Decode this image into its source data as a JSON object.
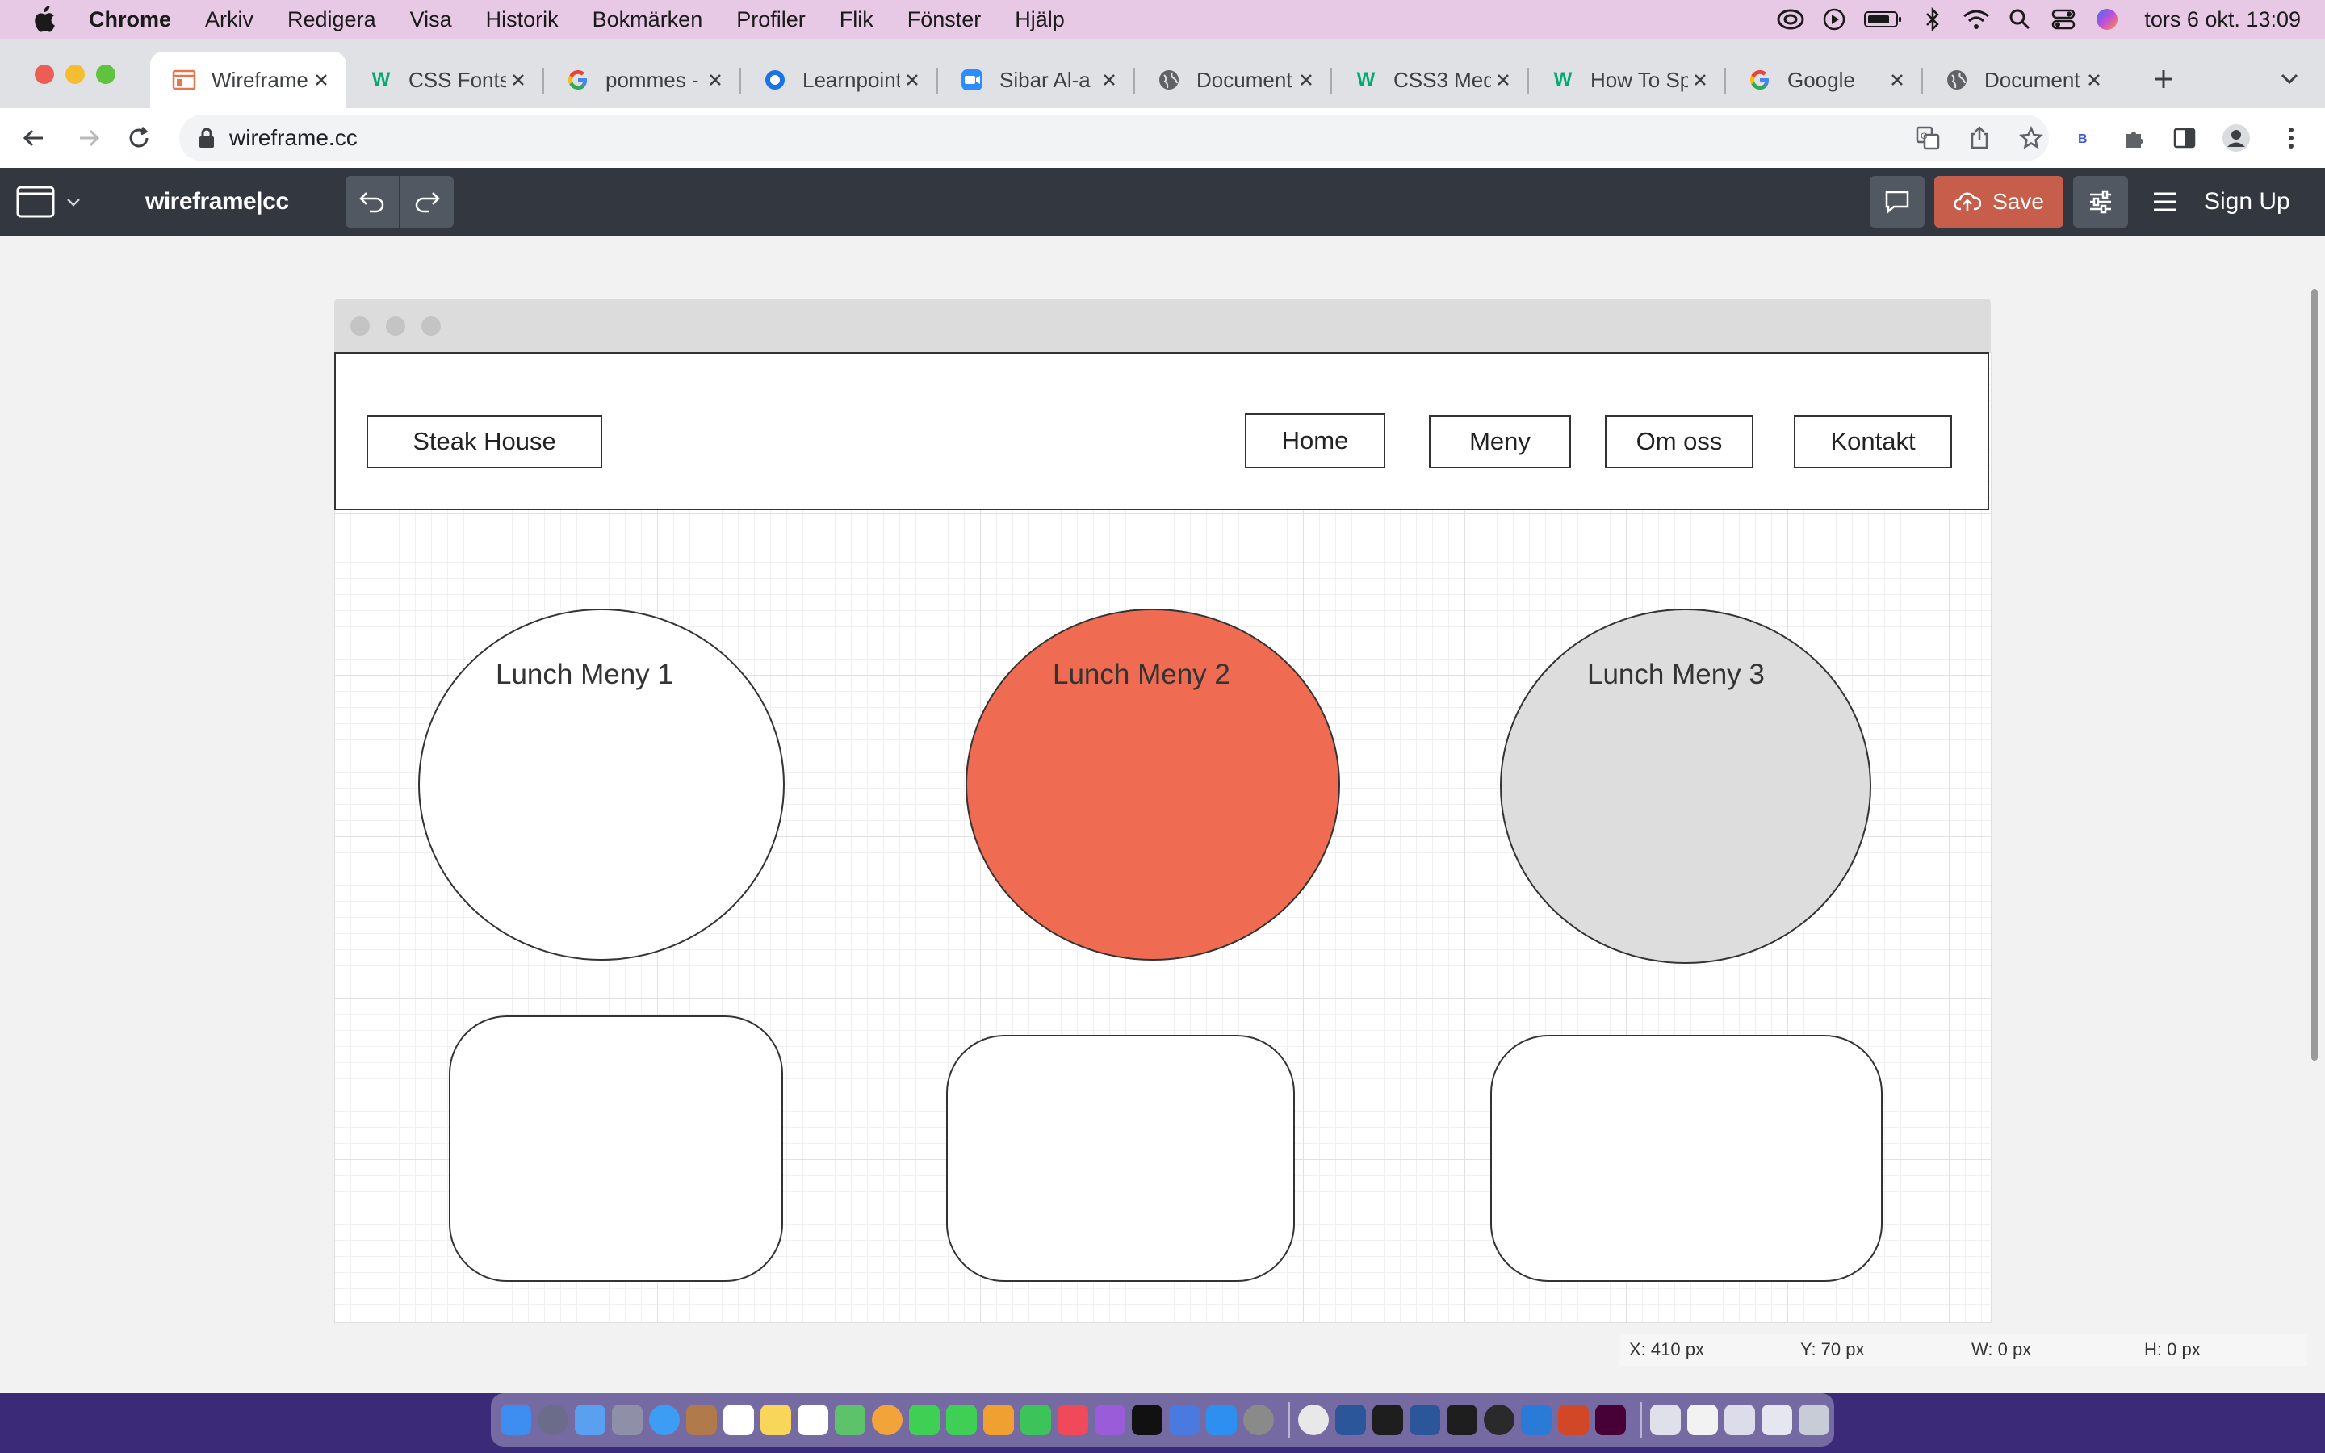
{
  "menubar": {
    "app_name": "Chrome",
    "items": [
      "Arkiv",
      "Redigera",
      "Visa",
      "Historik",
      "Bokmärken",
      "Profiler",
      "Flik",
      "Fönster",
      "Hjälp"
    ],
    "clock": "tors 6 okt.  13:09"
  },
  "tabs": [
    {
      "title": "Wireframe",
      "favicon": "wireframe-icon",
      "active": true
    },
    {
      "title": "CSS Fonts",
      "favicon": "w3schools-icon"
    },
    {
      "title": "pommes -",
      "favicon": "google-icon"
    },
    {
      "title": "Learnpoint",
      "favicon": "learnpoint-icon"
    },
    {
      "title": "Sibar Al-a",
      "favicon": "zoom-icon"
    },
    {
      "title": "Document",
      "favicon": "globe-icon"
    },
    {
      "title": "CSS3 Med",
      "favicon": "w3schools-icon"
    },
    {
      "title": "How To Sp",
      "favicon": "w3schools-icon"
    },
    {
      "title": "Google",
      "favicon": "google-icon"
    },
    {
      "title": "Document",
      "favicon": "globe-icon"
    }
  ],
  "address_bar": {
    "url": "wireframe.cc"
  },
  "app": {
    "brand": "wireframe|cc",
    "save_label": "Save",
    "signup_label": "Sign Up"
  },
  "wireframe": {
    "logo_label": "Steak House",
    "nav": [
      "Home",
      "Meny",
      "Om oss",
      "Kontakt"
    ],
    "circles": [
      {
        "label": "Lunch Meny 1",
        "fill": "#ffffff"
      },
      {
        "label": "Lunch Meny 2",
        "fill": "#ef6b51"
      },
      {
        "label": "Lunch Meny 3",
        "fill": "#dddddd"
      }
    ]
  },
  "status": {
    "x": "X: 410 px",
    "y": "Y: 70 px",
    "w": "W: 0 px",
    "h": "H: 0 px"
  },
  "colors": {
    "menubar": "#e7c9e6",
    "appbar": "#323740",
    "save": "#c75d4b",
    "accent_circle": "#ef6b51"
  }
}
